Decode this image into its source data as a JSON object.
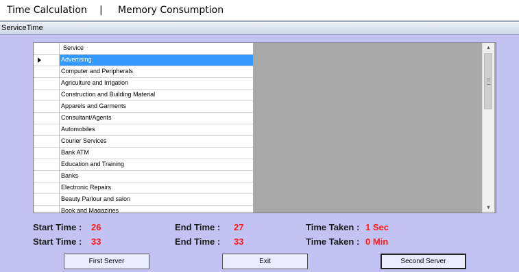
{
  "menu": {
    "time_calculation": "Time Calculation",
    "separator": "|",
    "memory_consumption": "Memory Consumption"
  },
  "panel": {
    "title": "ServiceTime"
  },
  "grid": {
    "column_header": "Service",
    "rows": [
      "Advertising",
      "Computer and Peripherals",
      "Agriculture and Irrigation",
      "Construction and Building Material",
      "Apparels and Garments",
      "Consultant/Agents",
      "Automobiles",
      "Courier Services",
      "Bank ATM",
      "Education and Training",
      "Banks",
      "Electronic Repairs",
      "Beauty Parlour and salon",
      "Book and Magazines"
    ],
    "selected_index": 0
  },
  "stats": {
    "row1": {
      "start_label": "Start Time :",
      "start_value": "26",
      "end_label": "End Time :",
      "end_value": "27",
      "taken_label": "Time Taken :",
      "taken_value": "1 Sec"
    },
    "row2": {
      "start_label": "Start Time :",
      "start_value": "33",
      "end_label": "End Time :",
      "end_value": "33",
      "taken_label": "Time Taken :",
      "taken_value": "0 Min"
    }
  },
  "buttons": {
    "first_server": "First Server",
    "exit": "Exit",
    "second_server": "Second Server"
  },
  "colors": {
    "panel_bg": "#c2c2f3",
    "value_red": "#ff1a1a",
    "selection": "#3399ff",
    "grid_empty": "#a9a9a9"
  },
  "icons": {
    "scroll_up": "scroll-up-arrow-icon",
    "scroll_down": "scroll-down-arrow-icon",
    "row_pointer": "row-pointer-icon"
  }
}
